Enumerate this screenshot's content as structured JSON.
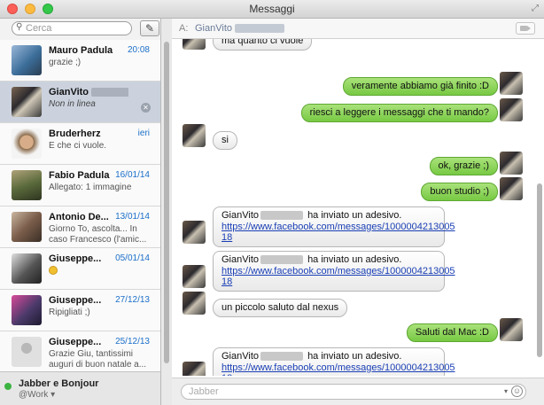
{
  "window": {
    "title": "Messaggi"
  },
  "sidebar": {
    "search_placeholder": "Cerca",
    "conversations": [
      {
        "name": "Mauro Padula",
        "date": "20:08",
        "preview": "grazie ;)",
        "avatar_color": "#3c6e9a"
      },
      {
        "name": "GianVito",
        "date": "",
        "preview": "Non in linea",
        "selected": true,
        "avatar_color": "#3a3a3a"
      },
      {
        "name": "Bruderherz",
        "date": "ieri",
        "preview": "E che ci vuole.",
        "avatar_color": "#8a6b4c"
      },
      {
        "name": "Fabio Padula",
        "date": "16/01/14",
        "preview": "Allegato: 1 immagine",
        "avatar_color": "#5b6b3c"
      },
      {
        "name": "Antonio De...",
        "date": "13/01/14",
        "preview": "Giorno To, ascolta... In caso Francesco (l'amic...",
        "avatar_color": "#7a5d4a"
      },
      {
        "name": "Giuseppe...",
        "date": "05/01/14",
        "preview": "",
        "emoji": true,
        "avatar_color": "#555555"
      },
      {
        "name": "Giuseppe...",
        "date": "27/12/13",
        "preview": "Ripigliati ;)",
        "avatar_color": "#4a3a6a"
      },
      {
        "name": "Giuseppe...",
        "date": "25/12/13",
        "preview": "Grazie Giu, tantissimi auguri di buon natale a...",
        "avatar_color": "#cfcfcf"
      }
    ],
    "account": {
      "name": "Jabber e Bonjour",
      "sub": "@Work"
    }
  },
  "header": {
    "to_label": "A:",
    "to_name": "GianVito"
  },
  "messages": {
    "m0": "ma quanto ci vuole",
    "m1": "veramente abbiamo già finito :D",
    "m2": "riesci a leggere i messaggi che ti mando?",
    "m3": "si",
    "m4": "ok, grazie ;)",
    "m5": "buon studio ;)",
    "card_sender": "GianVito",
    "card_text": "ha inviato un adesivo.",
    "card_link_a": "https://www.facebook.com/messages/1000004213005",
    "card_link_b": "18",
    "m9": "un piccolo saluto dal nexus",
    "m10": "Saluti dal Mac :D"
  },
  "input": {
    "placeholder": "Jabber"
  },
  "colors": {
    "outgoing_bubble": "#8fd35c",
    "incoming_bubble": "#f2f2f2",
    "selection": "#cbd2de",
    "date_blue": "#1b6fc9",
    "status_green": "#3cb341"
  }
}
